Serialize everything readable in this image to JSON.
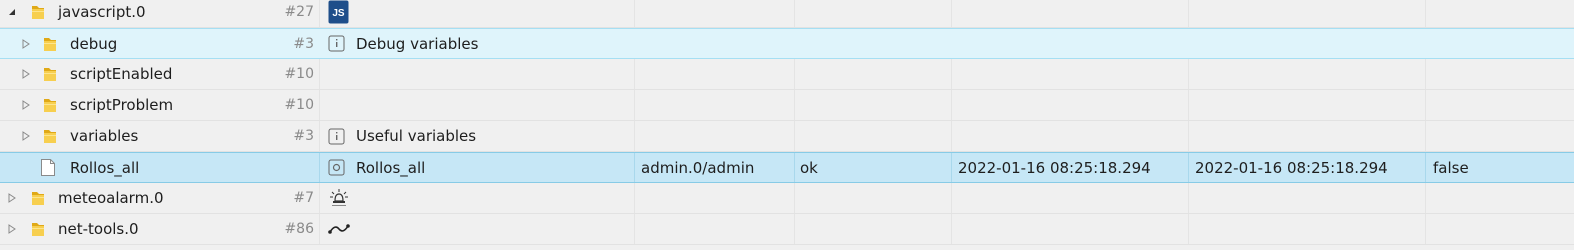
{
  "rows": [
    {
      "name": "javascript.0",
      "count": "#27",
      "expander": "expanded",
      "icon": "javascript-adapter-icon"
    },
    {
      "name": "debug",
      "count": "#3",
      "expander": "collapsed",
      "icon": "info-state-icon",
      "desc": "Debug variables"
    },
    {
      "name": "scriptEnabled",
      "count": "#10",
      "expander": "collapsed"
    },
    {
      "name": "scriptProblem",
      "count": "#10",
      "expander": "collapsed"
    },
    {
      "name": "variables",
      "count": "#3",
      "expander": "collapsed",
      "icon": "info-state-icon",
      "desc": "Useful variables"
    },
    {
      "name": "Rollos_all",
      "icon": "state-icon",
      "desc": "Rollos_all",
      "user": "admin.0/admin",
      "status": "ok",
      "ts": "2022-01-16 08:25:18.294",
      "lc": "2022-01-16 08:25:18.294",
      "value": "false"
    },
    {
      "name": "meteoalarm.0",
      "count": "#7",
      "expander": "collapsed",
      "icon": "meteoalarm-icon"
    },
    {
      "name": "net-tools.0",
      "count": "#86",
      "expander": "collapsed",
      "icon": "net-tools-icon"
    }
  ],
  "colors": {
    "folder": "#f2c12e",
    "js_badge": "#1e4e8a",
    "row_highlight": "#dff4fb",
    "row_selected": "#c6e7f6"
  }
}
